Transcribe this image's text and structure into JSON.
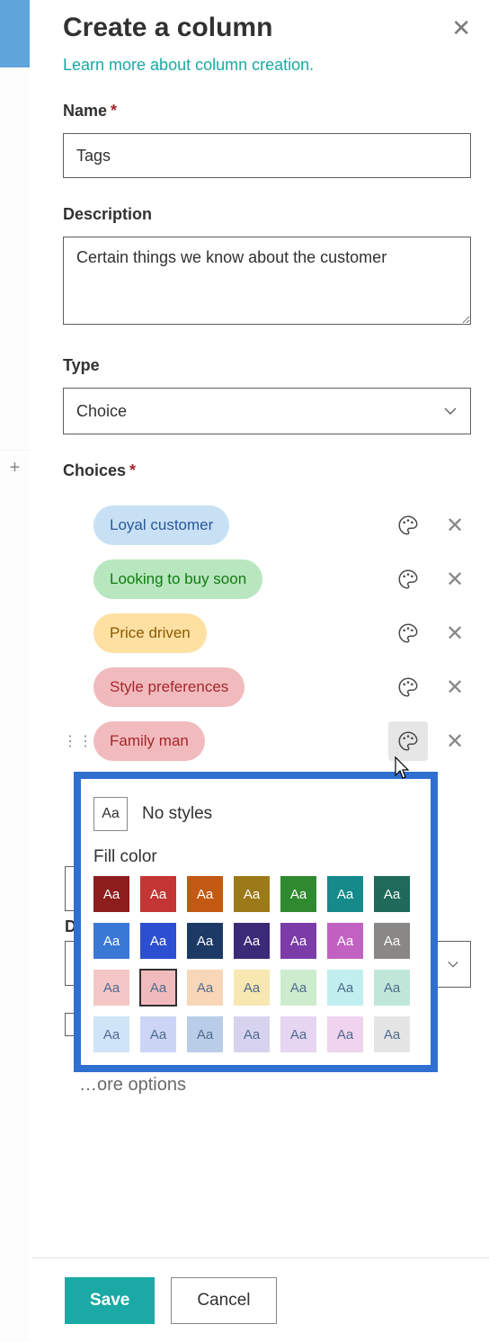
{
  "header": {
    "title": "Create a column",
    "learn_more": "Learn more about column creation."
  },
  "fields": {
    "name_label": "Name",
    "name_value": "Tags",
    "description_label": "Description",
    "description_value": "Certain things we know about the customer",
    "type_label": "Type",
    "type_value": "Choice",
    "choices_label": "Choices"
  },
  "choices": [
    {
      "label": "Loyal customer",
      "bg": "#c7e0f4",
      "fg": "#2b579a",
      "active": false
    },
    {
      "label": "Looking to buy soon",
      "bg": "#b8e6bf",
      "fg": "#107c10",
      "active": false
    },
    {
      "label": "Price driven",
      "bg": "#ffe0a3",
      "fg": "#8a5a00",
      "active": false
    },
    {
      "label": "Style preferences",
      "bg": "#f1bbbd",
      "fg": "#a4262c",
      "active": false
    },
    {
      "label": "Family man",
      "bg": "#f1bbbd",
      "fg": "#a4262c",
      "active": true
    }
  ],
  "color_popover": {
    "no_styles_label": "No styles",
    "fill_label": "Fill color",
    "swatches": [
      {
        "hex": "#8e1d1d",
        "dark": true
      },
      {
        "hex": "#c43535",
        "dark": true
      },
      {
        "hex": "#c25a13",
        "dark": true
      },
      {
        "hex": "#9c7a1a",
        "dark": true
      },
      {
        "hex": "#2f8a2f",
        "dark": true
      },
      {
        "hex": "#148a8a",
        "dark": true
      },
      {
        "hex": "#1f6a5a",
        "dark": true
      },
      {
        "hex": "#3a78d6",
        "dark": true
      },
      {
        "hex": "#2b4fd0",
        "dark": true
      },
      {
        "hex": "#1d3a66",
        "dark": true
      },
      {
        "hex": "#3a2a78",
        "dark": true
      },
      {
        "hex": "#7b3ba8",
        "dark": true
      },
      {
        "hex": "#c162c2",
        "dark": true
      },
      {
        "hex": "#8a8886",
        "dark": true
      },
      {
        "hex": "#f4c6c6",
        "dark": false
      },
      {
        "hex": "#f1bbbd",
        "dark": false,
        "selected": true
      },
      {
        "hex": "#f8d6b8",
        "dark": false
      },
      {
        "hex": "#f7e7b0",
        "dark": false
      },
      {
        "hex": "#cdeccd",
        "dark": false
      },
      {
        "hex": "#c1eeee",
        "dark": false
      },
      {
        "hex": "#bfe6d9",
        "dark": false
      },
      {
        "hex": "#cfe4f7",
        "dark": false
      },
      {
        "hex": "#ccd5f5",
        "dark": false
      },
      {
        "hex": "#b9cde8",
        "dark": false
      },
      {
        "hex": "#d7d3ef",
        "dark": false
      },
      {
        "hex": "#e6d6f1",
        "dark": false
      },
      {
        "hex": "#efd3ef",
        "dark": false
      },
      {
        "hex": "#e5e5e5",
        "dark": false
      }
    ]
  },
  "footer": {
    "save": "Save",
    "cancel": "Cancel"
  },
  "misc": {
    "aa": "Aa",
    "plus": "+",
    "more_options_fragment": "…ore options",
    "peeking_d": "D"
  }
}
